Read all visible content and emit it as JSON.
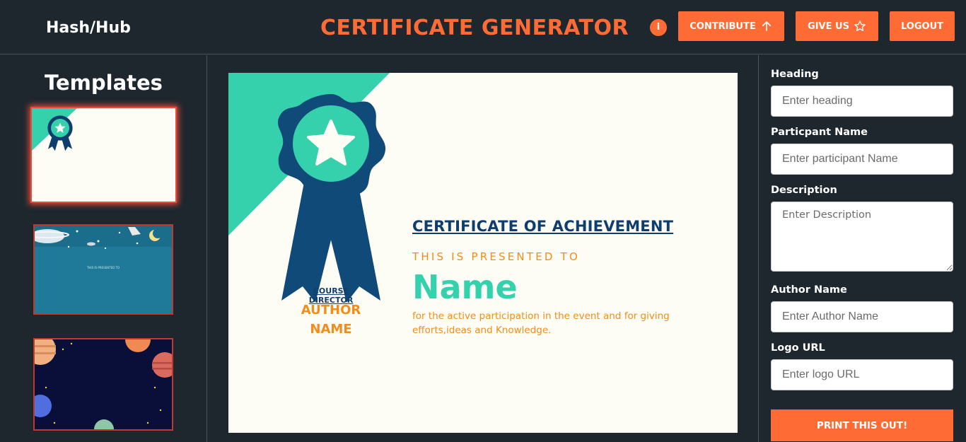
{
  "header": {
    "brand": "Hash/Hub",
    "title": "CERTIFICATE GENERATOR",
    "info_label": "i",
    "contribute_label": "CONTRIBUTE",
    "give_us_label": "GIVE US",
    "logout_label": "LOGOUT",
    "accent_color": "#ff6b35"
  },
  "sidebar": {
    "title": "Templates"
  },
  "certificate": {
    "heading": "CERTIFICATE OF ACHIEVEMENT",
    "presented_to": "THIS IS PRESENTED TO",
    "name": "Name",
    "description": "for the active participation in the event and for giving efforts,ideas and Knowledge.",
    "director_label": "COURSE DIRECTOR",
    "author_name": "AUTHOR NAME",
    "colors": {
      "teal": "#35d0ac",
      "navy": "#0f3e6e",
      "orange": "#f28c1a"
    }
  },
  "form": {
    "heading_label": "Heading",
    "heading_placeholder": "Enter heading",
    "participant_label": "Particpant Name",
    "participant_placeholder": "Enter participant Name",
    "description_label": "Description",
    "description_placeholder": "Enter Description",
    "author_label": "Author Name",
    "author_placeholder": "Enter Author Name",
    "logo_label": "Logo URL",
    "logo_placeholder": "Enter logo URL",
    "print_label": "PRINT THIS OUT!"
  },
  "template_preview_text": "THIS IS PRESENTED TO"
}
